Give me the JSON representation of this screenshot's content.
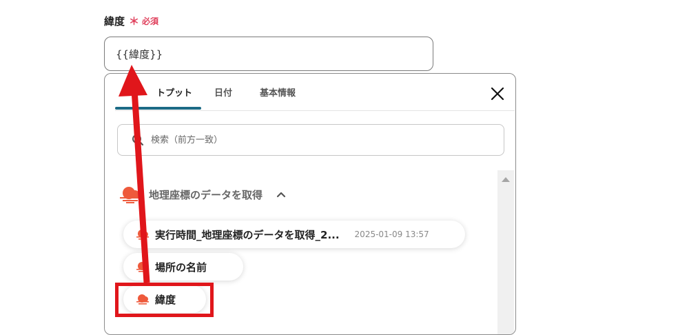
{
  "field": {
    "label": "緯度",
    "required_mark": "＊",
    "required_text": "必須",
    "value": "{{緯度}}"
  },
  "tabs": [
    {
      "label": "トプット",
      "active": true
    },
    {
      "label": "日付",
      "active": false
    },
    {
      "label": "基本情報",
      "active": false
    }
  ],
  "search": {
    "placeholder": "検索（前方一致）"
  },
  "group": {
    "title": "地理座標のデータを取得"
  },
  "items": [
    {
      "label": "実行時間_地理座標のデータを取得_2...",
      "meta": "2025-01-09 13:57"
    },
    {
      "label": "場所の名前"
    },
    {
      "label": "緯度"
    }
  ],
  "colors": {
    "accent_tab": "#1c6b86",
    "required": "#e0415d",
    "annotation_red": "#e0161b",
    "cloud_icon": "#ee5a3c"
  }
}
